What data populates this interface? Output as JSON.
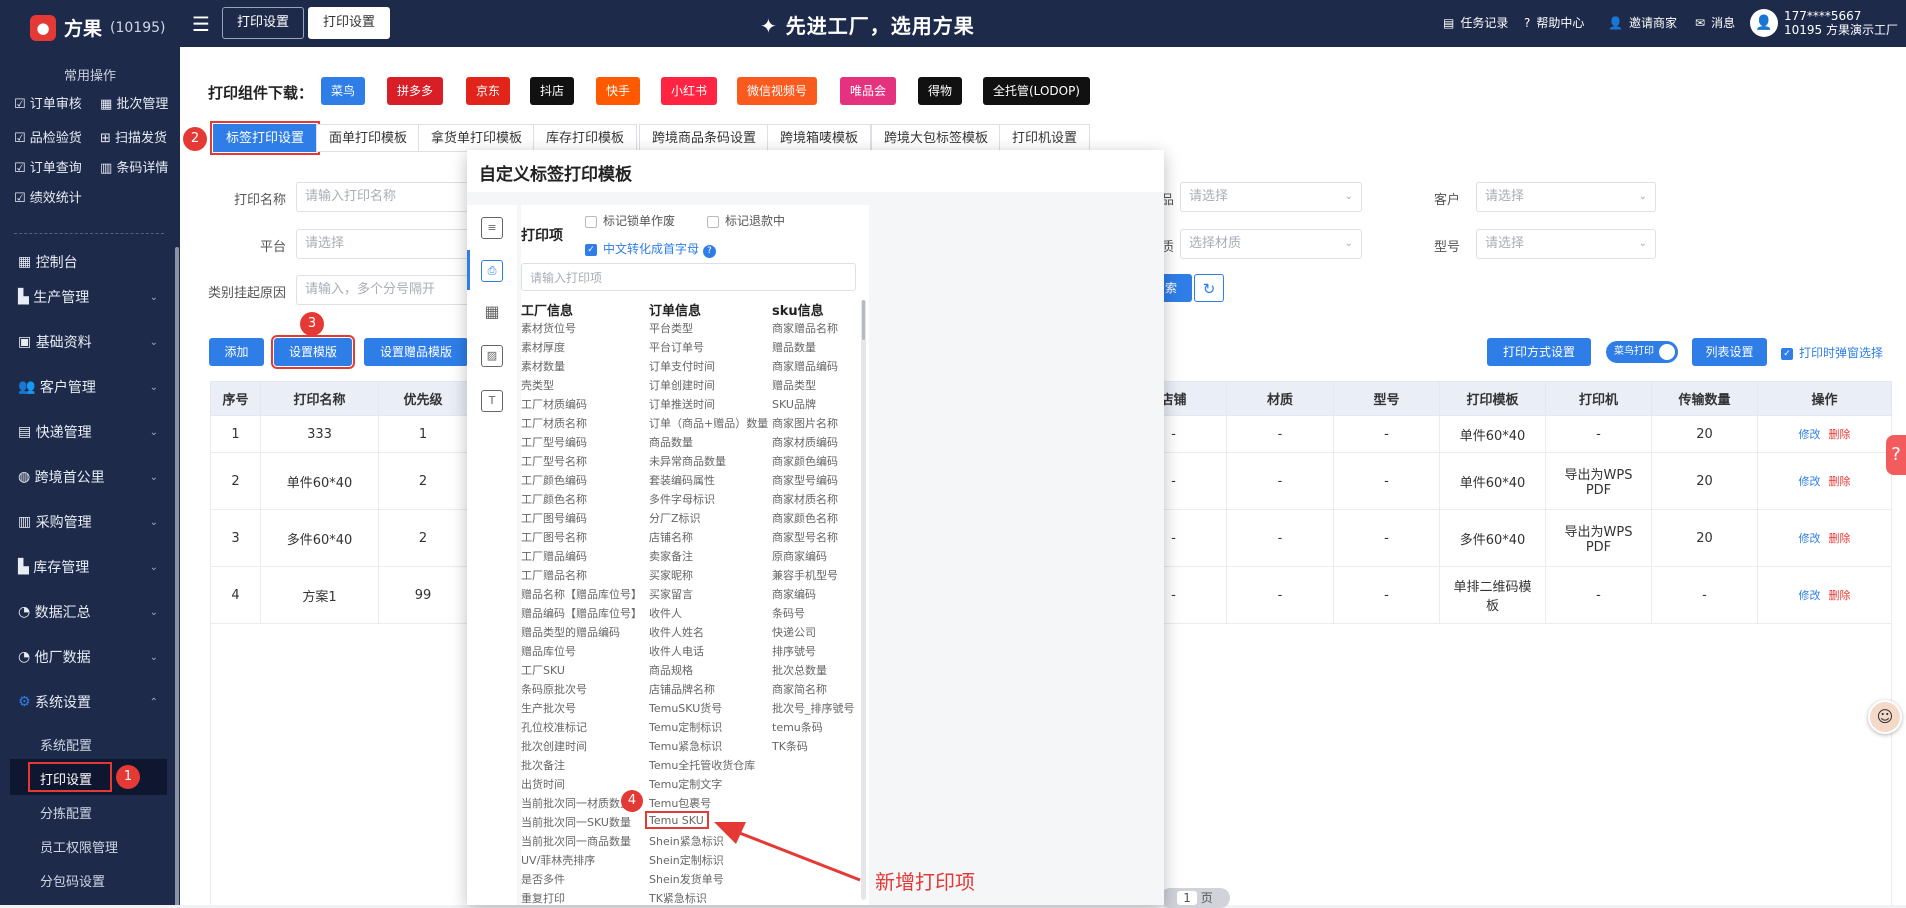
{
  "app": {
    "name": "方果",
    "id": "(10195)",
    "slogan": "先进工厂，选用方果"
  },
  "top_tabs": [
    "打印设置",
    "打印设置"
  ],
  "top_right": {
    "tasks": "任务记录",
    "help": "帮助中心",
    "invite": "邀请商家",
    "messages": "消息",
    "user_phone": "177****5667",
    "user_company": "10195 方果演示工厂"
  },
  "sidebar": {
    "quick_title": "常用操作",
    "quick_items": [
      "订单审核",
      "批次管理",
      "品检验货",
      "扫描发货",
      "订单查询",
      "条码详情",
      "绩效统计"
    ],
    "menus": [
      "控制台",
      "生产管理",
      "基础资料",
      "客户管理",
      "快递管理",
      "跨境首公里",
      "采购管理",
      "库存管理",
      "数据汇总",
      "他厂数据",
      "系统设置"
    ],
    "submenus": [
      "系统配置",
      "打印设置",
      "分拣配置",
      "员工权限管理",
      "分包码设置"
    ]
  },
  "download": {
    "label": "打印组件下载：",
    "buttons": [
      {
        "label": "菜鸟",
        "color": "#2f7ee8"
      },
      {
        "label": "拼多多",
        "color": "#d81e26"
      },
      {
        "label": "京东",
        "color": "#e1251b"
      },
      {
        "label": "抖店",
        "color": "#111111"
      },
      {
        "label": "快手",
        "color": "#ff5a00"
      },
      {
        "label": "小红书",
        "color": "#ff2442"
      },
      {
        "label": "微信视频号",
        "color": "#fa5a1e"
      },
      {
        "label": "唯品会",
        "color": "#e4327f"
      },
      {
        "label": "得物",
        "color": "#111111"
      },
      {
        "label": "全托管(LODOP)",
        "color": "#111111"
      }
    ]
  },
  "tabs": [
    "标签打印设置",
    "面单打印模板",
    "拿货单打印模板",
    "库存打印模板",
    "跨境商品条码设置",
    "跨境箱唛模板",
    "跨境大包标签模板",
    "打印机设置"
  ],
  "filters": {
    "print_name": "打印名称",
    "print_name_ph": "请输入打印名称",
    "platform": "平台",
    "platform_ph": "请选择",
    "category": "类别挂起原因",
    "category_ph": "请输入，多个分号隔开",
    "product_ph": "请选择",
    "material_ph": "选择材质",
    "customer": "客户",
    "customer_ph": "请选择",
    "model": "型号",
    "model_ph": "请选择",
    "product_suffix": "品",
    "material_suffix": "质",
    "search_frag": "索"
  },
  "actions": {
    "add": "添加",
    "set_template": "设置模版",
    "set_gift": "设置赠品模版",
    "print_mode": "打印方式设置",
    "cainiao_toggle": "菜鸟打印",
    "column_settings": "列表设置",
    "popup_check": "打印时弹窗选择"
  },
  "table": {
    "headers_left": [
      "序号",
      "打印名称",
      "优先级"
    ],
    "headers_right": [
      "店铺",
      "材质",
      "型号",
      "打印模板",
      "打印机",
      "传输数量",
      "操作"
    ],
    "rows": [
      {
        "no": "1",
        "name": "333",
        "priority": "1",
        "shop": "-",
        "material": "-",
        "model": "-",
        "template": "单件60*40",
        "printer": "-",
        "count": "20"
      },
      {
        "no": "2",
        "name": "单件60*40",
        "priority": "2",
        "shop": "-",
        "material": "-",
        "model": "-",
        "template": "单件60*40",
        "printer": "导出为WPS PDF",
        "count": "20"
      },
      {
        "no": "3",
        "name": "多件60*40",
        "priority": "2",
        "shop": "-",
        "material": "-",
        "model": "-",
        "template": "多件60*40",
        "printer": "导出为WPS PDF",
        "count": "20"
      },
      {
        "no": "4",
        "name": "方案1",
        "priority": "99",
        "shop": "-",
        "material": "-",
        "model": "-",
        "template": "单排二维码模板",
        "printer": "-",
        "count": "-"
      }
    ],
    "edit": "修改",
    "del": "删除"
  },
  "modal": {
    "title": "自定义标签打印模板",
    "print_items": "打印项",
    "opt1": "标记锁单作废",
    "opt2": "标记退款中",
    "opt3": "中文转化成首字母",
    "search_ph": "请输入打印项",
    "col1_title": "工厂信息",
    "col2_title": "订单信息",
    "col3_title": "sku信息",
    "col1": [
      "素材货位号",
      "素材厚度",
      "素材数量",
      "壳类型",
      "工厂材质编码",
      "工厂材质名称",
      "工厂型号编码",
      "工厂型号名称",
      "工厂颜色编码",
      "工厂颜色名称",
      "工厂图号编码",
      "工厂图号名称",
      "工厂赠品编码",
      "工厂赠品名称",
      "赠品名称【赠品库位号】",
      "赠品编码【赠品库位号】",
      "赠品类型的赠品编码",
      "赠品库位号",
      "工厂SKU",
      "条码原批次号",
      "生产批次号",
      "孔位校准标记",
      "批次创建时间",
      "批次备注",
      "出货时间",
      "当前批次同一材质数量",
      "当前批次同一SKU数量",
      "当前批次同一商品数量",
      "UV/菲林壳排序",
      "是否多件",
      "重复打印"
    ],
    "col2": [
      "平台类型",
      "平台订单号",
      "订单支付时间",
      "订单创建时间",
      "订单推送时间",
      "订单（商品+赠品）数量",
      "商品数量",
      "未异常商品数量",
      "套装编码属性",
      "多件字母标识",
      "分厂Z标识",
      "店铺名称",
      "卖家备注",
      "买家昵称",
      "买家留言",
      "收件人",
      "收件人姓名",
      "收件人电话",
      "商品规格",
      "店铺品牌名称",
      "TemuSKU货号",
      "Temu定制标识",
      "Temu紧急标识",
      "Temu全托管收货仓库",
      "Temu定制文字",
      "Temu包裹号",
      "Temu SKU",
      "Shein紧急标识",
      "Shein定制标识",
      "Shein发货单号",
      "TK紧急标识"
    ],
    "col3": [
      "商家赠品名称",
      "赠品数量",
      "商家赠品编码",
      "赠品类型",
      "SKU品牌",
      "商家图片名称",
      "商家材质编码",
      "商家颜色编码",
      "商家型号编码",
      "商家材质名称",
      "商家颜色名称",
      "商家型号名称",
      "原商家编码",
      "兼容手机型号",
      "商家编码",
      "条码号",
      "快递公司",
      "排序號号",
      "批次总数量",
      "商家简名称",
      "批次号_排序號号",
      "temu条码",
      "TK条码"
    ]
  },
  "annotation": {
    "new_item": "新增打印项",
    "badges": [
      "1",
      "2",
      "3",
      "4"
    ]
  },
  "pagination": {
    "page": "1",
    "unit": "页"
  }
}
